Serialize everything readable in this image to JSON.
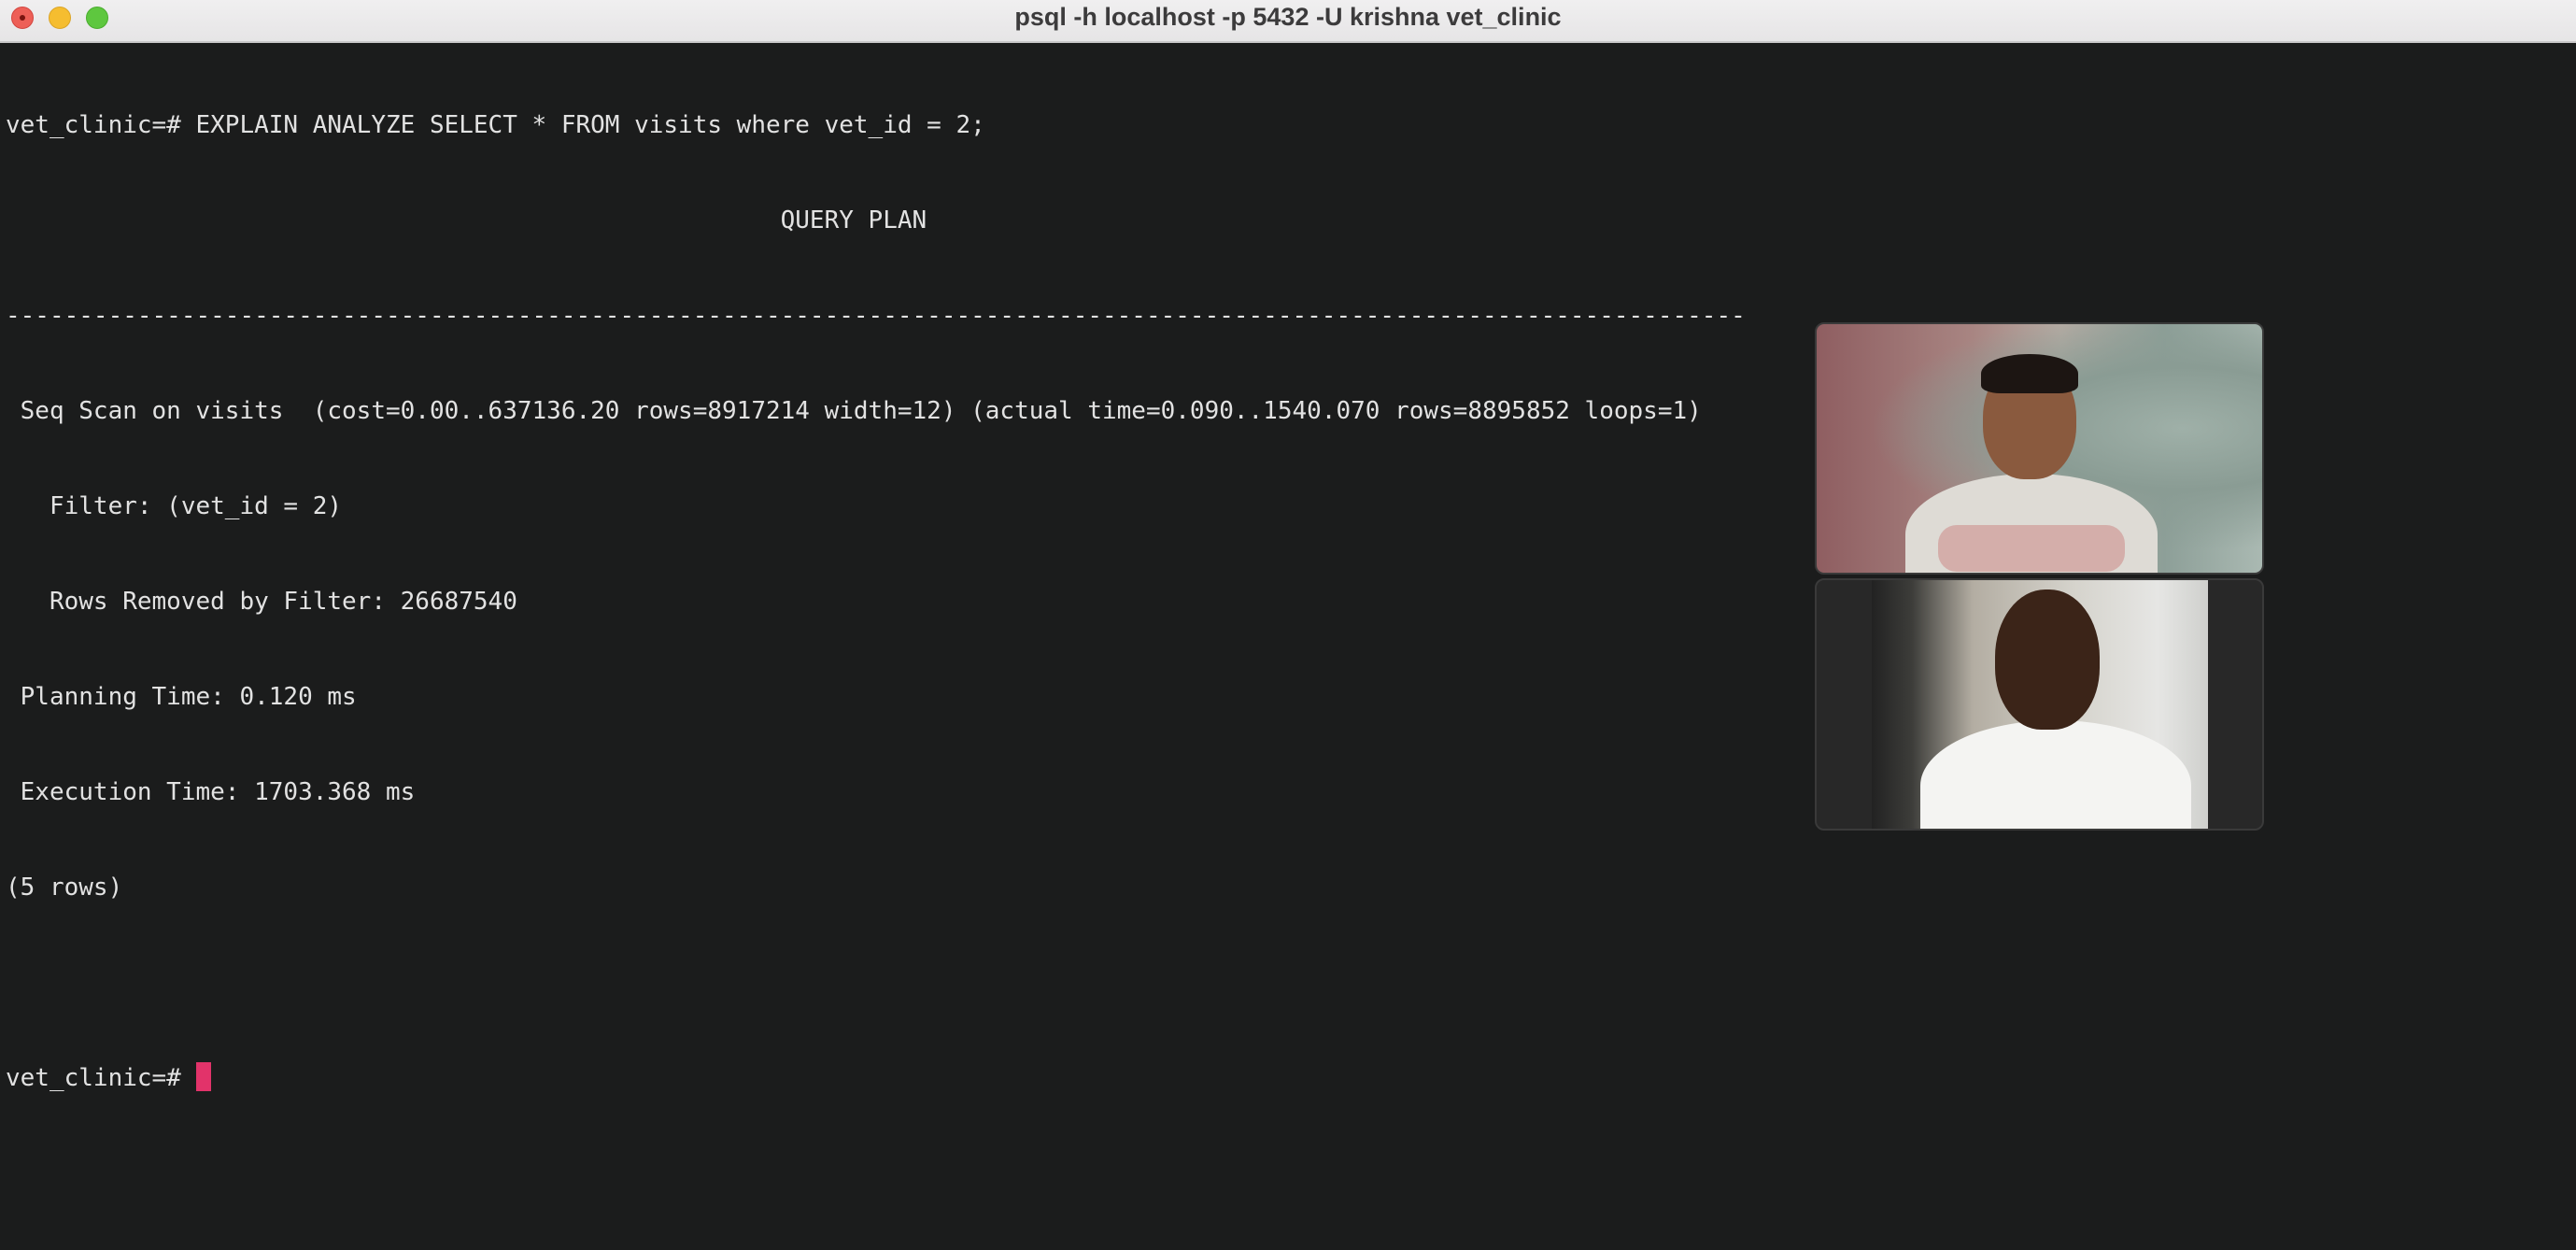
{
  "window": {
    "title": "psql -h localhost -p 5432 -U krishna vet_clinic",
    "controls": {
      "close_icon": "close-icon",
      "minimize_icon": "minimize-icon",
      "zoom_icon": "zoom-icon",
      "close_color": "#ed5f57",
      "minimize_color": "#f5bd30",
      "zoom_color": "#5ec73f"
    }
  },
  "terminal": {
    "background": "#1b1c1c",
    "foreground": "#e2e2e2",
    "cursor_color": "#e2336a",
    "lines": [
      "vet_clinic=# EXPLAIN ANALYZE SELECT * FROM visits where vet_id = 2;",
      "                                                     QUERY PLAN",
      "-----------------------------------------------------------------------------------------------------------------------",
      " Seq Scan on visits  (cost=0.00..637136.20 rows=8917214 width=12) (actual time=0.090..1540.070 rows=8895852 loops=1)",
      "   Filter: (vet_id = 2)",
      "   Rows Removed by Filter: 26687540",
      " Planning Time: 0.120 ms",
      " Execution Time: 1703.368 ms",
      "(5 rows)",
      ""
    ],
    "prompt": "vet_clinic=# "
  },
  "video_call": {
    "participants": [
      {
        "name": "participant-1",
        "feed": "webcam-video"
      },
      {
        "name": "participant-2",
        "feed": "webcam-video"
      }
    ]
  }
}
